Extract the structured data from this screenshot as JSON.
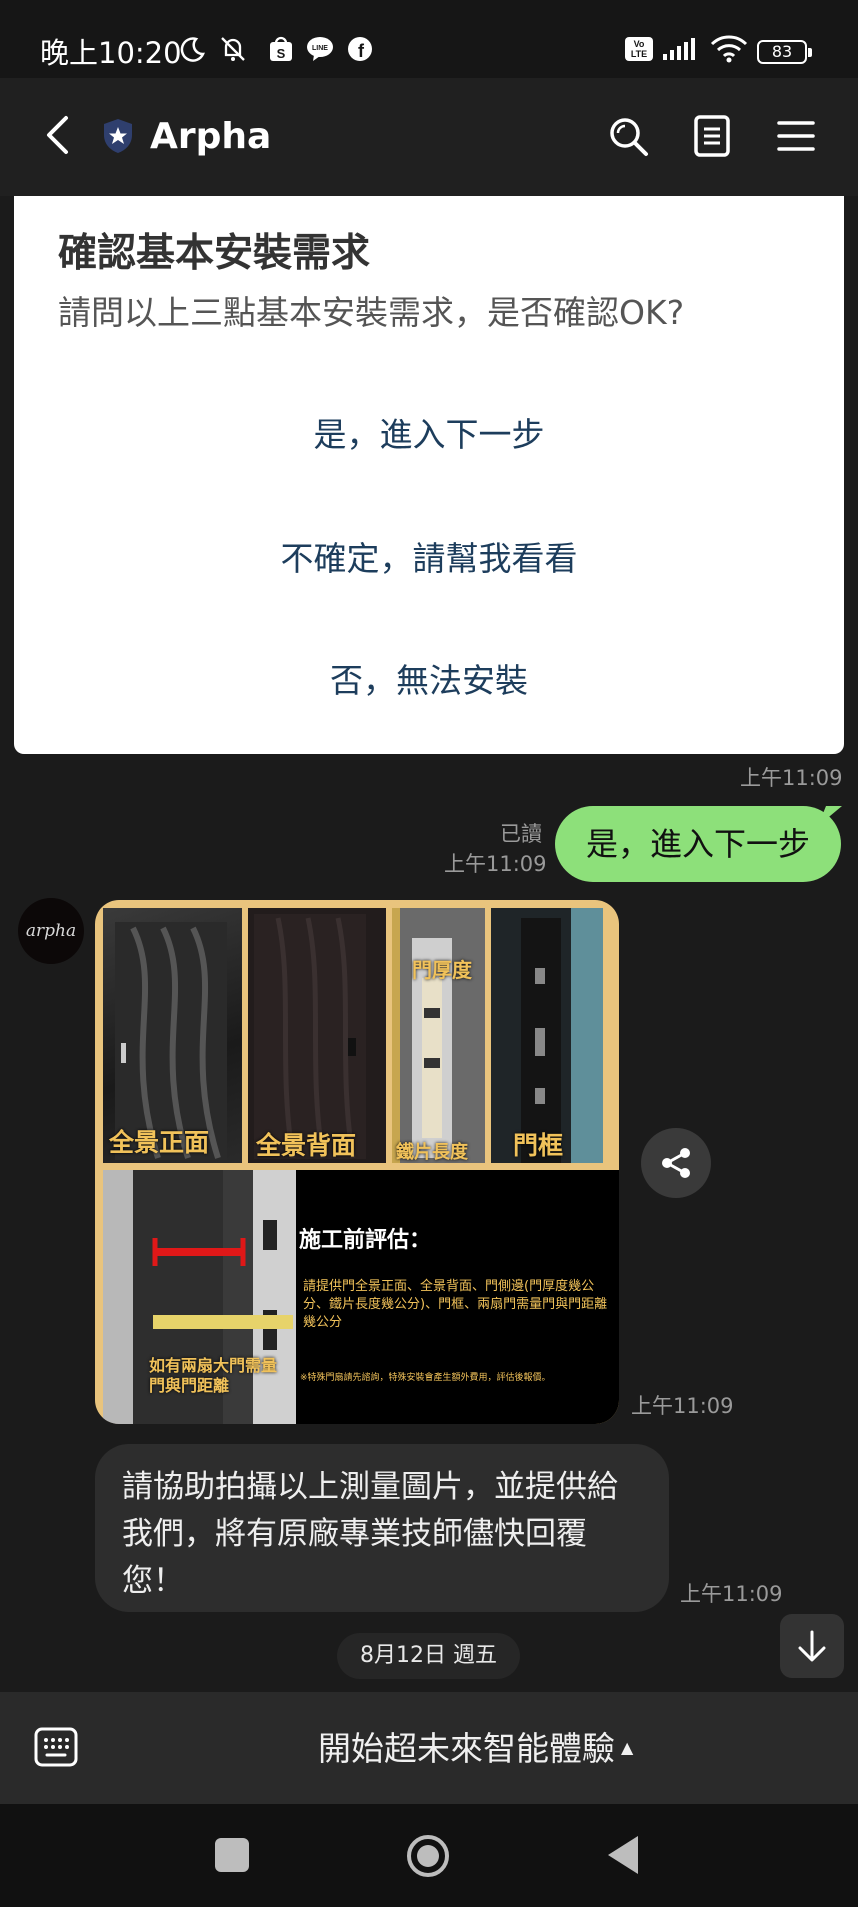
{
  "status_bar": {
    "time": "晚上10:20",
    "battery": "83",
    "icons": [
      "moon-icon",
      "notifications-off-icon",
      "shopee-icon",
      "line-icon",
      "facebook-icon",
      "volte-icon",
      "signal-icon",
      "wifi-icon",
      "battery-icon"
    ]
  },
  "header": {
    "title": "Arpha",
    "icons": [
      "back-arrow-icon",
      "official-badge-icon",
      "search-icon",
      "notes-icon",
      "menu-icon"
    ]
  },
  "quick_reply": {
    "title": "確認基本安裝需求",
    "subtitle": "請問以上三點基本安裝需求，是否確認OK?",
    "options": [
      "是，進入下一步",
      "不確定，請幫我看看",
      "否，無法安裝"
    ],
    "time": "上午11:09"
  },
  "my_message": {
    "text": "是，進入下一步",
    "read": "已讀",
    "time": "上午11:09"
  },
  "avatar": {
    "text": "arpha"
  },
  "image_message": {
    "labels": {
      "front": "全景正面",
      "back": "全景背面",
      "thickness": "門厚度",
      "plate_length": "鐵片長度",
      "frame": "門框",
      "double_door": "如有兩扇大門需量門與門距離"
    },
    "heading": "施工前評估：",
    "body": "請提供門全景正面、全景背面、門側邊(門厚度幾公分、鐵片長度幾公分)、門框、兩扇門需量門與門距離幾公分",
    "note": "※特殊門扇請先諮詢，特殊安裝會產生額外費用，評估後報價。",
    "time": "上午11:09"
  },
  "text_message": {
    "text": "請協助拍攝以上測量圖片，並提供給我們，將有原廠專業技師儘快回覆您！",
    "time": "上午11:09"
  },
  "date_separator": "8月12日 週五",
  "rich_menu": {
    "label": "開始超未來智能體驗",
    "toggle": "▲"
  },
  "nav": [
    "recents-icon",
    "home-icon",
    "back-icon"
  ]
}
